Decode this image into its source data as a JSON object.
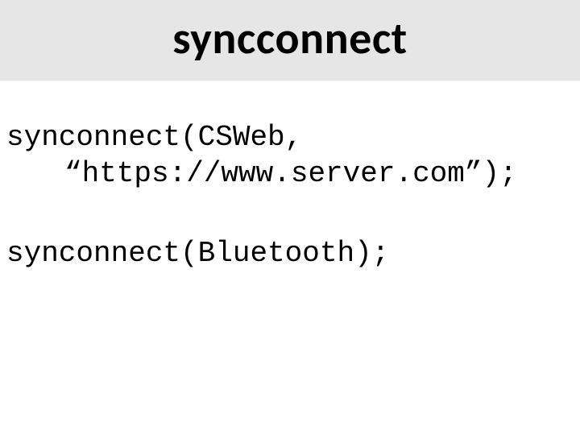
{
  "title": "syncconnect",
  "code": {
    "block1": {
      "line1": "synconnect(CSWeb,",
      "line2_indented": "“https://www.server.com”);"
    },
    "block2": {
      "line1": "synconnect(Bluetooth);"
    }
  }
}
